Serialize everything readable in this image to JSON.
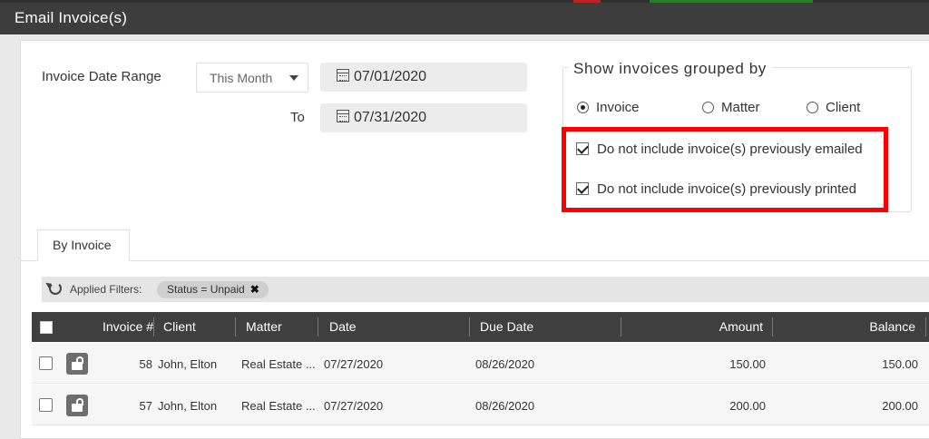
{
  "window": {
    "title": "Email Invoice(s)"
  },
  "form": {
    "date_range_label": "Invoice Date Range",
    "range_select_value": "This Month",
    "from_date": "07/01/2020",
    "to_label": "To",
    "to_date": "07/31/2020"
  },
  "grouping": {
    "legend": "Show invoices grouped by",
    "options": [
      {
        "label": "Invoice",
        "selected": true
      },
      {
        "label": "Matter",
        "selected": false
      },
      {
        "label": "Client",
        "selected": false
      }
    ],
    "checkboxes": [
      {
        "label": "Do not include invoice(s) previously emailed",
        "checked": true
      },
      {
        "label": "Do not include invoice(s) previously printed",
        "checked": true
      }
    ],
    "highlight_color": "#ff0000"
  },
  "tabs": [
    {
      "label": "By Invoice",
      "active": true
    }
  ],
  "filters": {
    "label": "Applied Filters:",
    "chips": [
      {
        "text": "Status = Unpaid"
      }
    ]
  },
  "table": {
    "columns": [
      "Invoice #",
      "Client",
      "Matter",
      "Date",
      "Due Date",
      "Amount",
      "Balance"
    ],
    "rows": [
      {
        "invoice": "58",
        "client": "John, Elton",
        "matter": "Real Estate ...",
        "date": "07/27/2020",
        "due_date": "08/26/2020",
        "amount": "150.00",
        "balance": "150.00"
      },
      {
        "invoice": "57",
        "client": "John, Elton",
        "matter": "Real Estate ...",
        "date": "07/27/2020",
        "due_date": "08/26/2020",
        "amount": "200.00",
        "balance": "200.00"
      }
    ]
  }
}
